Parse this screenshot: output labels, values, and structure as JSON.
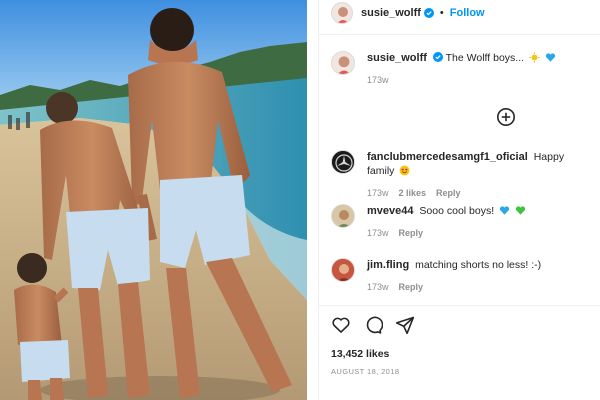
{
  "post": {
    "author": "susie_wolff",
    "separator": "•",
    "follow_label": "Follow"
  },
  "caption": {
    "username": "susie_wolff",
    "text": "The Wolff boys...",
    "time": "173w"
  },
  "comments": [
    {
      "username": "fanclubmercedesamgf1_oficial",
      "text": "Happy family",
      "time": "173w",
      "likes": "2 likes",
      "reply": "Reply"
    },
    {
      "username": "mveve44",
      "text": "Sooo cool boys!",
      "time": "173w",
      "reply": "Reply"
    },
    {
      "username": "jim.fling",
      "text": "matching shorts no less! :-)",
      "time": "173w",
      "reply": "Reply"
    }
  ],
  "likes": "13,452 likes",
  "date": "AUGUST 18, 2018",
  "colors": {
    "accent": "#0095f6",
    "verified": "#0095f6",
    "muted": "#8e8e8e",
    "text": "#262626"
  },
  "icons": {
    "load_more": "plus-circle-icon",
    "like": "heart-icon",
    "comment": "comment-bubble-icon",
    "share": "paper-plane-icon",
    "verified": "verified-badge-icon"
  }
}
